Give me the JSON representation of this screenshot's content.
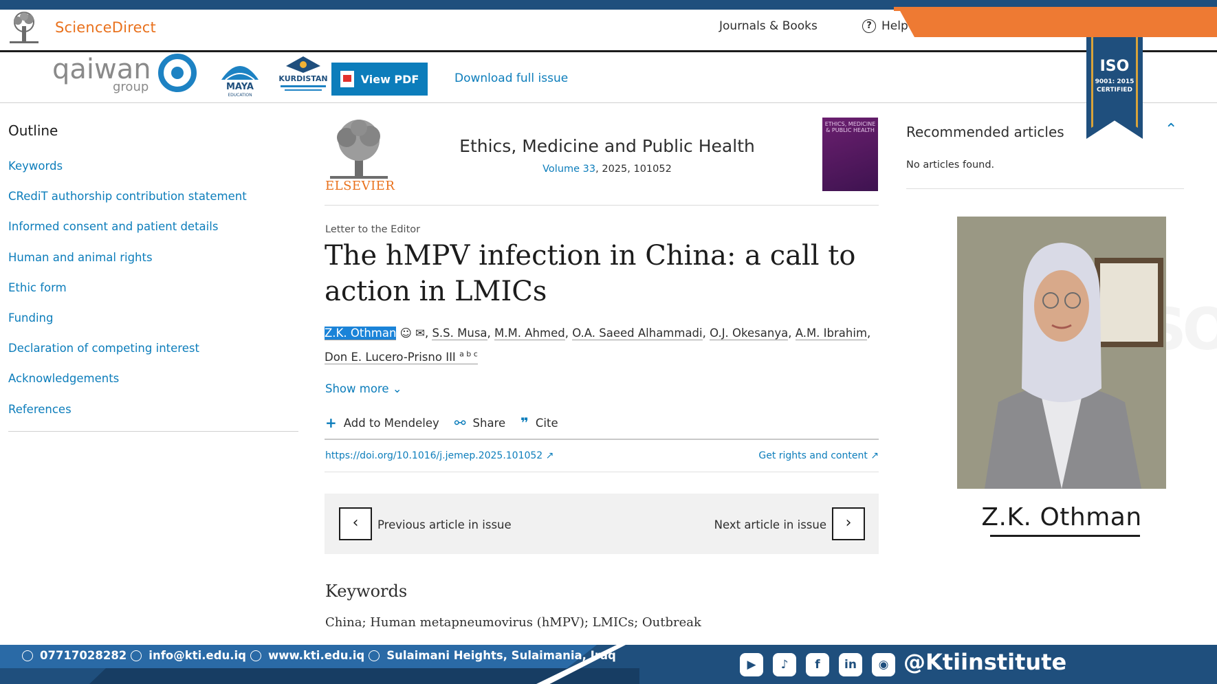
{
  "header": {
    "brand": "ScienceDirect",
    "nav": {
      "journals": "Journals & Books",
      "help": "Help"
    }
  },
  "toolbar": {
    "view_pdf": "View PDF",
    "download_issue": "Download full issue",
    "logos": {
      "qaiwan": "qaiwan",
      "qaiwan_sub": "group",
      "maya": "MAYA",
      "maya_sub": "EDUCATION",
      "kurdistan": "KURDISTAN"
    }
  },
  "iso_badge": {
    "title": "ISO",
    "line1": "9001: 2015",
    "line2": "CERTIFIED"
  },
  "outline": {
    "title": "Outline",
    "items": [
      "Keywords",
      "CRediT authorship contribution statement",
      "Informed consent and patient details",
      "Human and animal rights",
      "Ethic form",
      "Funding",
      "Declaration of competing interest",
      "Acknowledgements",
      "References"
    ]
  },
  "journal": {
    "publisher": "ELSEVIER",
    "title": "Ethics, Medicine and Public Health",
    "volume_link": "Volume 33",
    "volume_rest": ", 2025, 101052",
    "cover_text": "ETHICS, MEDICINE & PUBLIC HEALTH"
  },
  "article": {
    "type": "Letter to the Editor",
    "title": "The hMPV infection in China: a call to action in LMICs",
    "authors": [
      "Z.K. Othman",
      "S.S. Musa",
      "M.M. Ahmed",
      "O.A. Saeed Alhammadi",
      "O.J. Okesanya",
      "A.M. Ibrahim",
      "Don E. Lucero-Prisno III"
    ],
    "last_author_sup": "a b c",
    "show_more": "Show more",
    "actions": {
      "mendeley": "Add to Mendeley",
      "share": "Share",
      "cite": "Cite"
    },
    "doi": "https://doi.org/10.1016/j.jemep.2025.101052",
    "rights": "Get rights and content",
    "prev": "Previous article in issue",
    "next": "Next article in issue",
    "keywords_heading": "Keywords",
    "keywords": "China; Human metapneumovirus (hMPV); LMICs; Outbreak"
  },
  "recommended": {
    "title": "Recommended articles",
    "empty": "No articles found."
  },
  "profile": {
    "name": "Z.K. Othman"
  },
  "watermark": "ISO",
  "footer": {
    "phone": "07717028282",
    "email": "info@kti.edu.iq",
    "website": "www.kti.edu.iq",
    "address": "Sulaimani Heights, Sulaimania, Iraq",
    "social_icons": [
      "youtube-icon",
      "tiktok-icon",
      "facebook-icon",
      "linkedin-icon",
      "instagram-icon"
    ],
    "handle": "@Ktiinstitute"
  },
  "colors": {
    "link": "#0c7dbb",
    "brand_orange": "#e9711c",
    "banner_blue": "#1f4f7d",
    "highlight": "#1a83d8"
  }
}
